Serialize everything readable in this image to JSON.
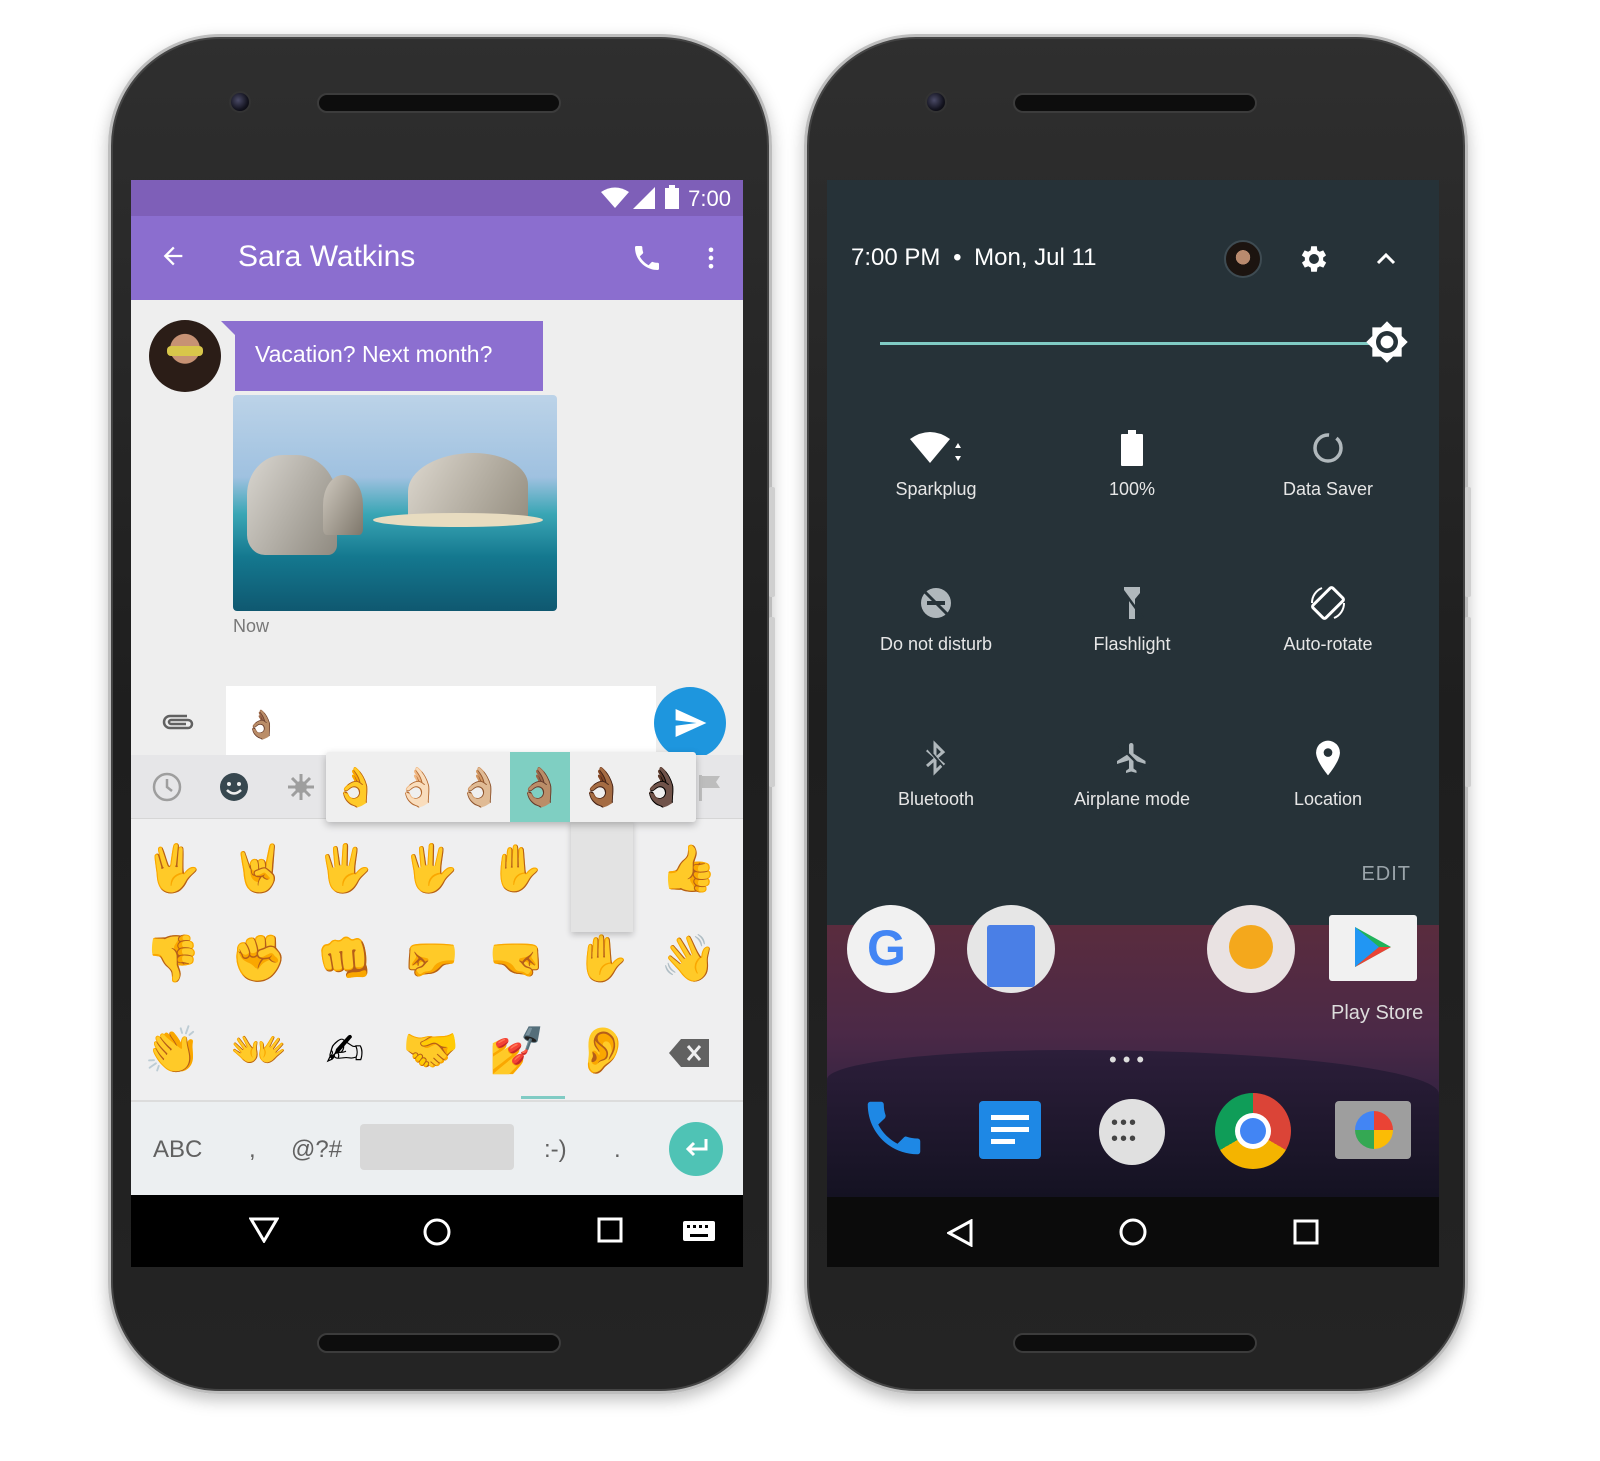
{
  "left_phone": {
    "status_bar": {
      "time": "7:00"
    },
    "app_bar": {
      "title": "Sara Watkins",
      "back_icon": "arrow-back-icon",
      "call_icon": "phone-icon",
      "menu_icon": "more-vert-icon"
    },
    "chat": {
      "message_text": "Vacation? Next month?",
      "timestamp": "Now"
    },
    "compose": {
      "value": "👌🏽"
    },
    "skin_tones": [
      "👌",
      "👌🏻",
      "👌🏼",
      "👌🏽",
      "👌🏾",
      "👌🏿"
    ],
    "skin_tone_selected_index": 3,
    "emoji_categories": [
      "recent-icon",
      "smiley-icon",
      "nature-icon",
      "food-icon",
      "travel-icon",
      "activity-icon",
      "objects-icon",
      "symbols-icon",
      "flags-icon"
    ],
    "emoji_rows": [
      [
        "🖖",
        "🤘",
        "🖐",
        "🖐",
        "✋",
        "",
        "👍"
      ],
      [
        "👎",
        "✊",
        "👊",
        "🤛",
        "🤜",
        "✋",
        "👋"
      ],
      [
        "👏",
        "👐",
        "✍",
        "🤝",
        "💅",
        "👂",
        ""
      ]
    ],
    "keyboard": {
      "abc": "ABC",
      "comma": ",",
      "symbols": "@?#",
      "smiley": ":-)",
      "period": "."
    },
    "colors": {
      "primary": "#8b6ecf",
      "status": "#7e5fb8",
      "send": "#1e96de",
      "enter": "#4fc3b5"
    }
  },
  "right_phone": {
    "header": {
      "time": "7:00 PM",
      "separator": "•",
      "date": "Mon, Jul 11"
    },
    "tiles": [
      {
        "label": "Sparkplug",
        "icon": "wifi-icon"
      },
      {
        "label": "100%",
        "icon": "battery-icon"
      },
      {
        "label": "Data Saver",
        "icon": "data-saver-icon"
      },
      {
        "label": "Do not disturb",
        "icon": "dnd-icon"
      },
      {
        "label": "Flashlight",
        "icon": "flashlight-icon"
      },
      {
        "label": "Auto-rotate",
        "icon": "auto-rotate-icon"
      },
      {
        "label": "Bluetooth",
        "icon": "bluetooth-icon"
      },
      {
        "label": "Airplane mode",
        "icon": "airplane-icon"
      },
      {
        "label": "Location",
        "icon": "location-icon"
      }
    ],
    "edit_label": "EDIT",
    "home": {
      "play_store_label": "Play Store"
    },
    "colors": {
      "panel": "#263238",
      "accent": "#80cbc4"
    }
  }
}
